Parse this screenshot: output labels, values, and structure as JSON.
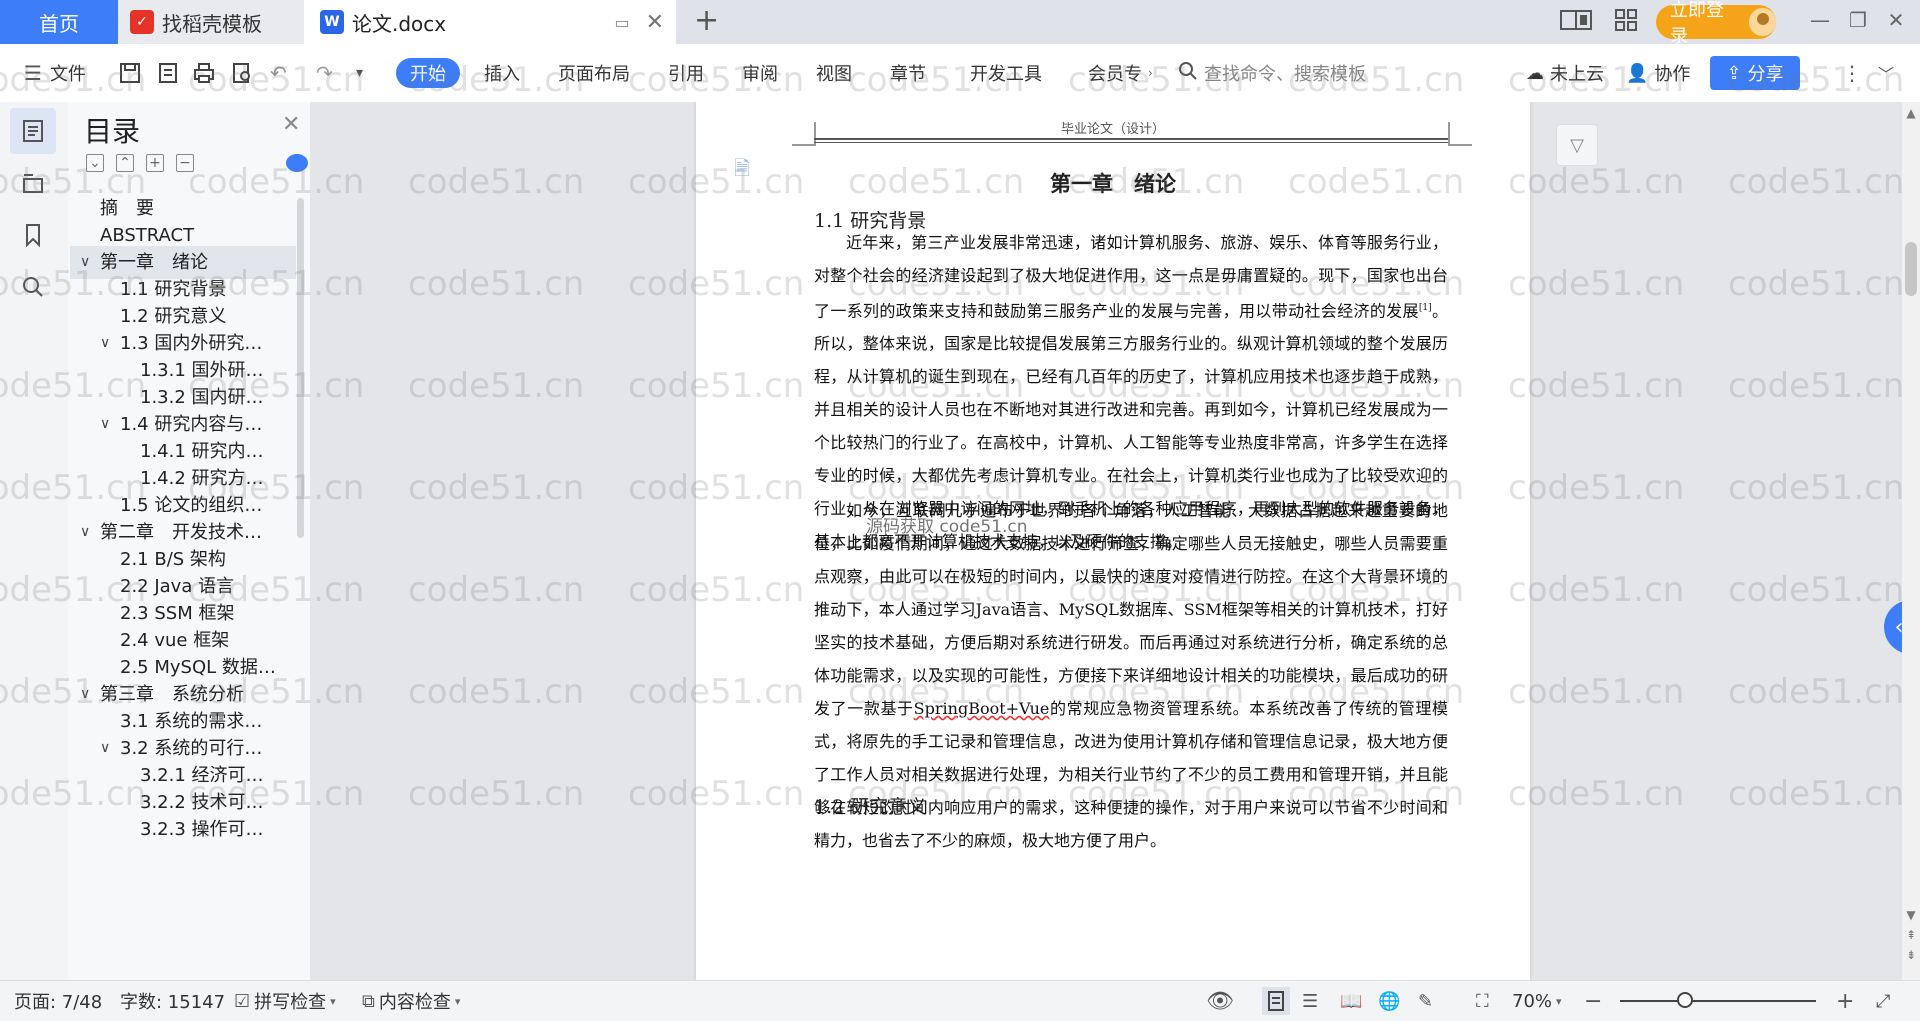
{
  "tabs": {
    "home": "首页",
    "templates": "找稻壳模板",
    "document": "论文.docx",
    "new_tab_symbol": "+"
  },
  "titlebar": {
    "login": "立即登录"
  },
  "ribbon": {
    "file_menu": "文件",
    "tabs": [
      "开始",
      "插入",
      "页面布局",
      "引用",
      "审阅",
      "视图",
      "章节",
      "开发工具",
      "会员专"
    ],
    "search_placeholder": "查找命令、搜索模板",
    "cloud": "未上云",
    "collaborate": "协作",
    "share": "分享"
  },
  "toc": {
    "title": "目录",
    "items": [
      {
        "text": "摘　要",
        "level": 1,
        "arrow": ""
      },
      {
        "text": "ABSTRACT",
        "level": 1,
        "arrow": ""
      },
      {
        "text": "第一章　绪论",
        "level": 1,
        "arrow": "down",
        "active": true
      },
      {
        "text": "1.1 研究背景",
        "level": 2,
        "arrow": ""
      },
      {
        "text": "1.2 研究意义",
        "level": 2,
        "arrow": ""
      },
      {
        "text": "1.3 国内外研究…",
        "level": 2,
        "arrow": "down"
      },
      {
        "text": "1.3.1 国外研…",
        "level": 3,
        "arrow": ""
      },
      {
        "text": "1.3.2 国内研…",
        "level": 3,
        "arrow": ""
      },
      {
        "text": "1.4 研究内容与…",
        "level": 2,
        "arrow": "down"
      },
      {
        "text": "1.4.1 研究内…",
        "level": 3,
        "arrow": ""
      },
      {
        "text": "1.4.2 研究方…",
        "level": 3,
        "arrow": ""
      },
      {
        "text": "1.5 论文的组织…",
        "level": 2,
        "arrow": ""
      },
      {
        "text": "第二章　开发技术…",
        "level": 1,
        "arrow": "down"
      },
      {
        "text": "2.1 B/S 架构",
        "level": 2,
        "arrow": ""
      },
      {
        "text": "2.2 Java 语言",
        "level": 2,
        "arrow": ""
      },
      {
        "text": "2.3 SSM 框架",
        "level": 2,
        "arrow": ""
      },
      {
        "text": "2.4 vue 框架",
        "level": 2,
        "arrow": ""
      },
      {
        "text": "2.5 MySQL 数据…",
        "level": 2,
        "arrow": ""
      },
      {
        "text": "第三章　系统分析",
        "level": 1,
        "arrow": "down"
      },
      {
        "text": "3.1 系统的需求…",
        "level": 2,
        "arrow": ""
      },
      {
        "text": "3.2 系统的可行…",
        "level": 2,
        "arrow": "down"
      },
      {
        "text": "3.2.1 经济可…",
        "level": 3,
        "arrow": ""
      },
      {
        "text": "3.2.2 技术可…",
        "level": 3,
        "arrow": ""
      },
      {
        "text": "3.2.3 操作可…",
        "level": 3,
        "arrow": ""
      }
    ]
  },
  "document": {
    "running_header": "毕业论文（设计）",
    "chapter_title": "第一章　绪论",
    "section1_title": "1.1 研究背景",
    "para1_a": "近年来，第三产业发展非常迅速，诸如计算机服务、旅游、娱乐、体育等服务行业，对整个社会的经济建设起到了极大地促进作用，这一点是毋庸置疑的。现下，国家也出台了一系列的政策来支持和鼓励第三服务产业的发展与完善，用以带动社会经济的发展",
    "para1_cite": "[1]",
    "para1_b": "。所以，整体来说，国家是比较提倡发展第三方服务行业的。纵观计算机领域的整个发展历程，从计算机的诞生到现在，已经有几百年的历史了，计算机应用技术也逐步趋于成熟，并且相关的设计人员也在不断地对其进行改进和完善。再到如今，计算机已经发展成为一个比较热门的行业了。在高校中，计算机、人工智能等专业热度非常高，许多学生在选择专业的时候，大都优先考虑计算机专业。在社会上，计算机类行业也成为了比较受欢迎的行业，从在浏览器中访问的网址，到手机上的各种应用程序，再到大型的软件服务设备，基本上都离不开计算机技术支持，以及硬件的支撑。",
    "para2_a": "如今，互联网几乎遍布于世界的各个角落，人工智能、大数据占据越来越重要的地位，比如疫情期间，通过大数据技术进行筛查，确定哪些人员无接触史，哪些人员需要重点观察，由此可以在极短的时间内，以最快的速度对疫情进行防控。在这个大背景环境的推动下，本人通过学习Java语言、MySQL数据库、SSM框架等相关的计算机技术，打好坚实的技术基础，方便后期对系统进行研发。而后再通过对系统进行分析，确定系统的总体功能需求，以及实现的可能性，方便接下来详细地设计相关的功能模块，最后成功的研发了一款基于",
    "para2_wavy": "SpringBoot+Vue",
    "para2_b": "的常规应急物资管理系统。本系统改善了传统的管理模式，将原先的手工记录和管理信息，改进为使用计算机存储和管理信息记录，极大地方便了工作人员对相关数据进行处理，为相关行业节约了不少的员工费用和管理开销，并且能够在较短的时间内响应用户的需求，这种便捷的操作，对于用户来说可以节省不少时间和精力，也省去了不少的麻烦，极大地方便了用户。",
    "section2_title": "1.2 研究意义",
    "overlay_text": "源码获取 code51.cn"
  },
  "statusbar": {
    "page": "页面: 7/48",
    "words": "字数: 15147",
    "spell_check": "拼写检查",
    "content_check": "内容检查",
    "zoom": "70%"
  },
  "watermark": "code51.cn",
  "colors": {
    "accent": "#3d7df7",
    "login": "#f5a41a",
    "wps_red": "#e5332a"
  }
}
